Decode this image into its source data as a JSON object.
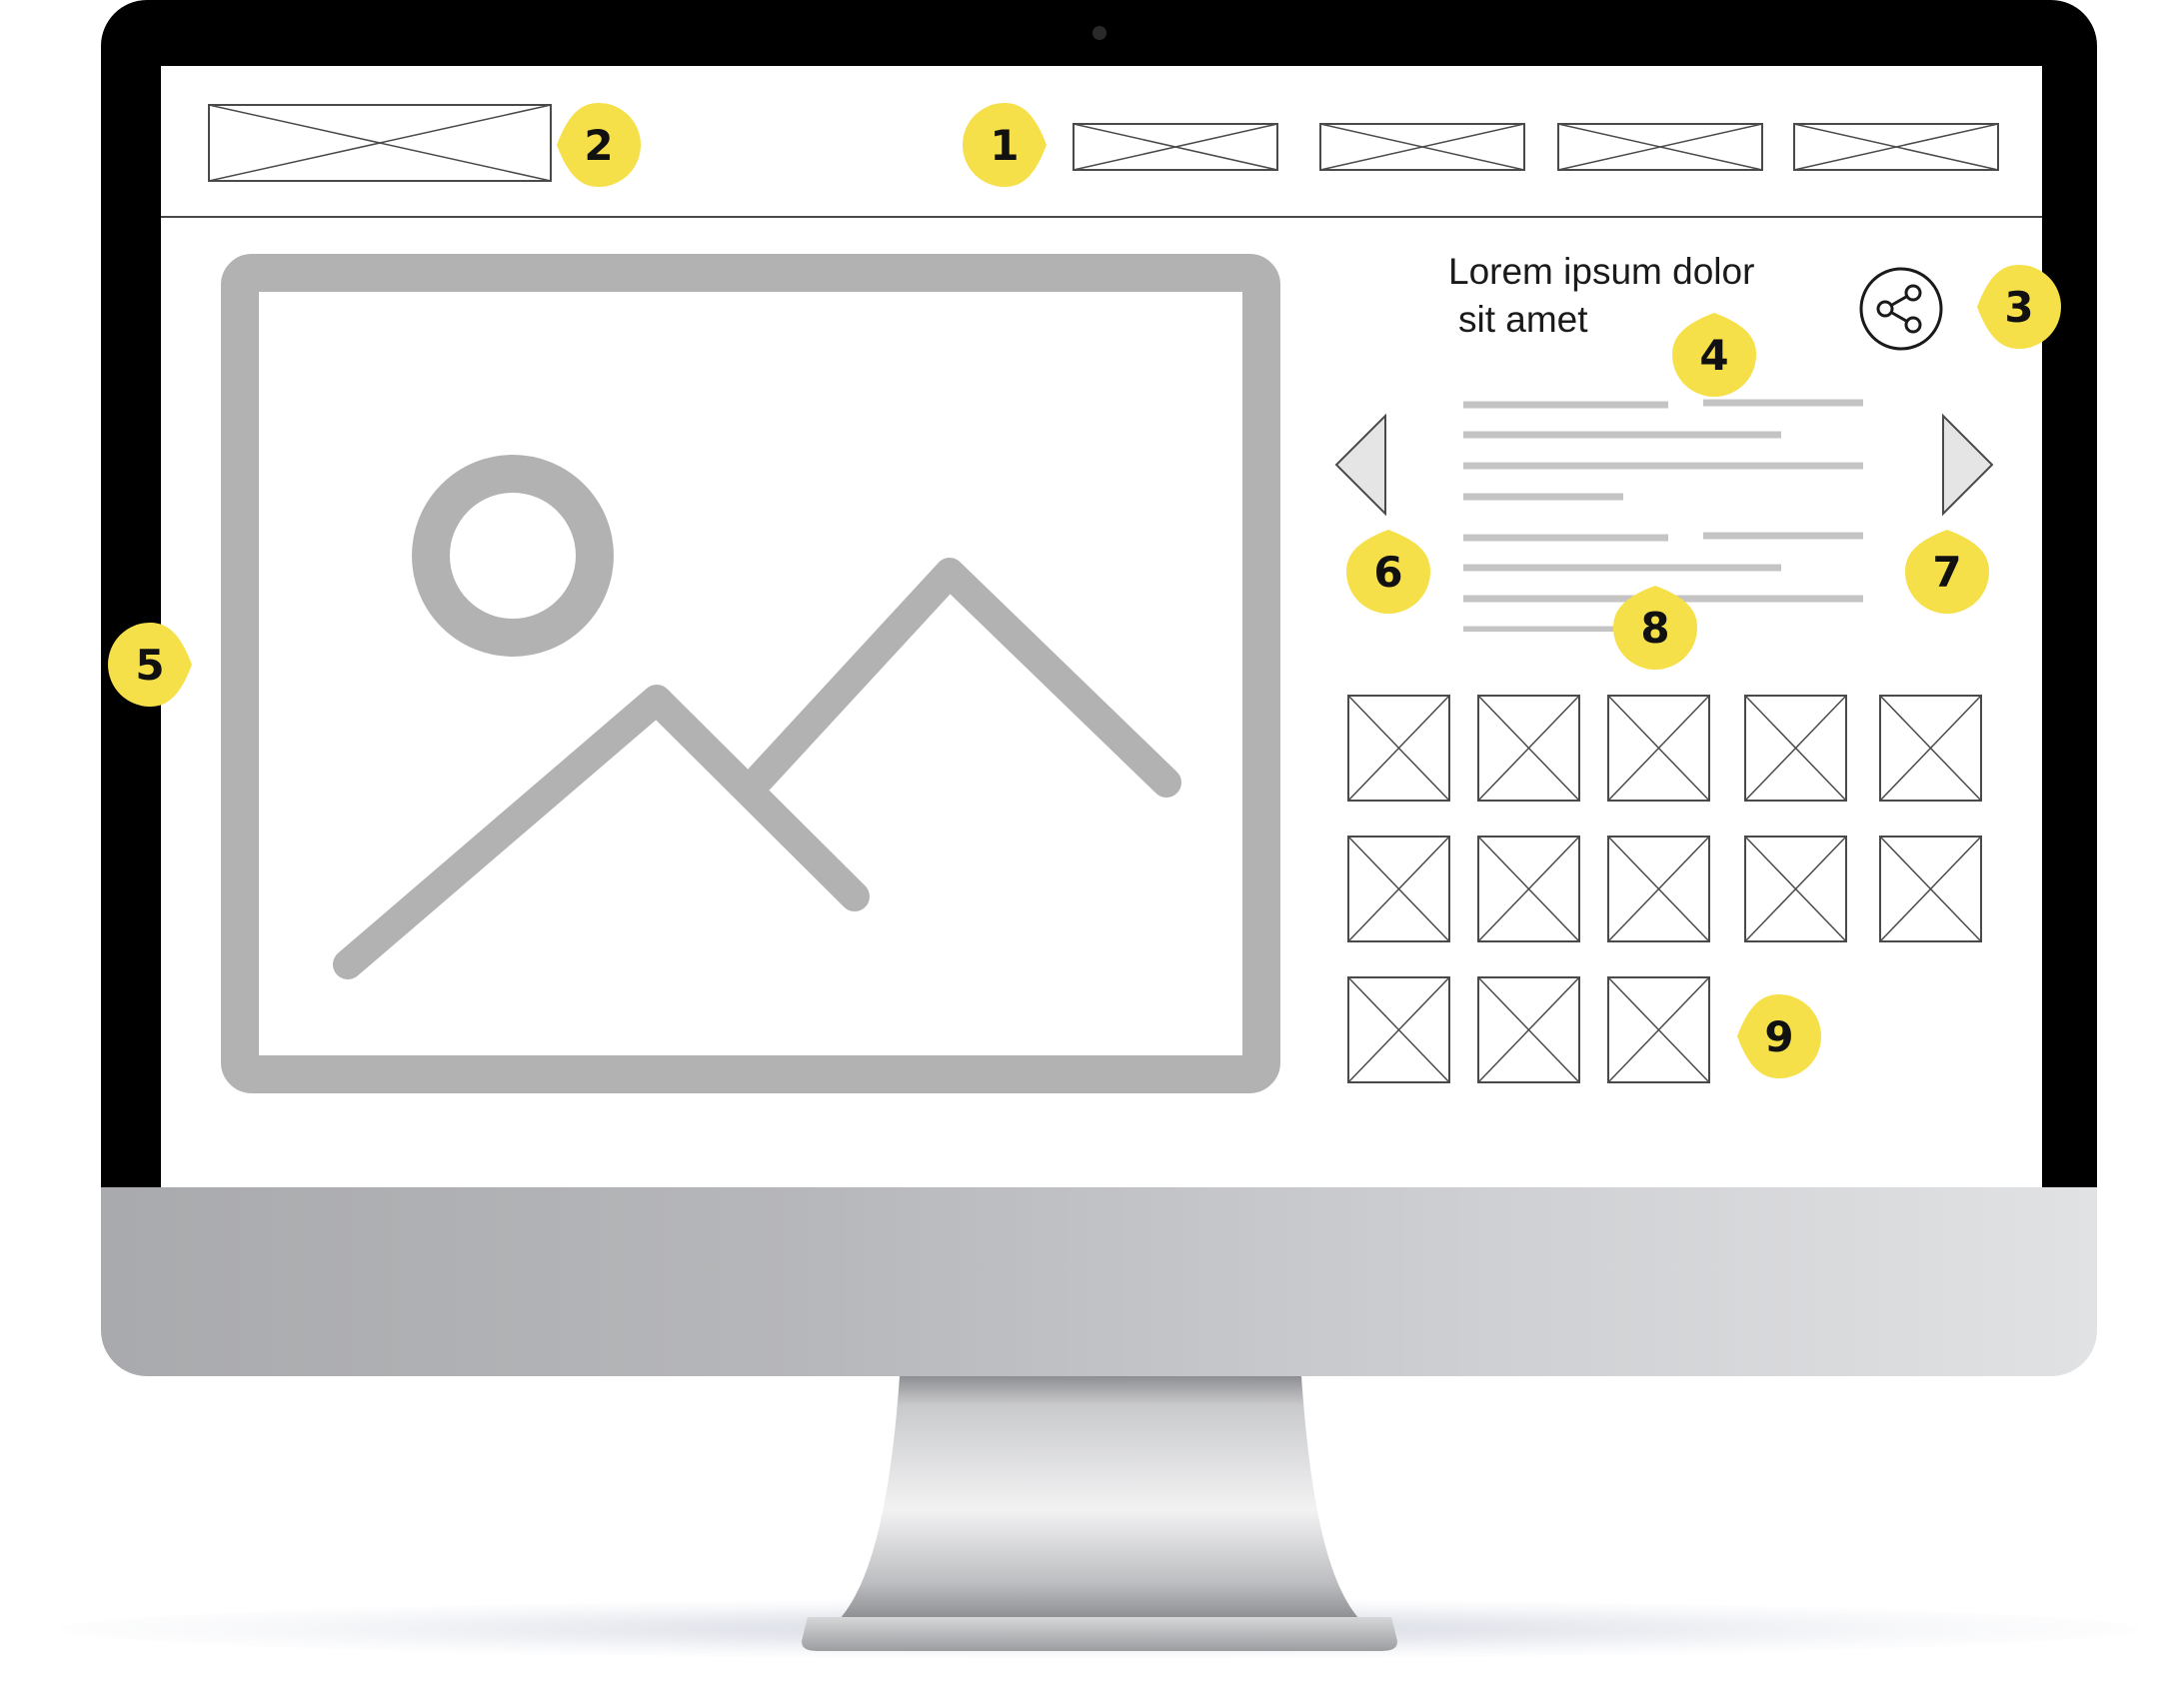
{
  "wireframe": {
    "title_line1": "Lorem ipsum dolor",
    "title_line2": "sit amet"
  },
  "colors": {
    "callout": "#f6e04a",
    "wire_gray": "#b2b2b2",
    "outline": "#4a4a4a"
  },
  "icons": {
    "share": "share-icon",
    "prev": "triangle-left-icon",
    "next": "triangle-right-icon",
    "image": "image-placeholder-icon"
  },
  "callouts": [
    "1",
    "2",
    "3",
    "4",
    "5",
    "6",
    "7",
    "8",
    "9"
  ]
}
